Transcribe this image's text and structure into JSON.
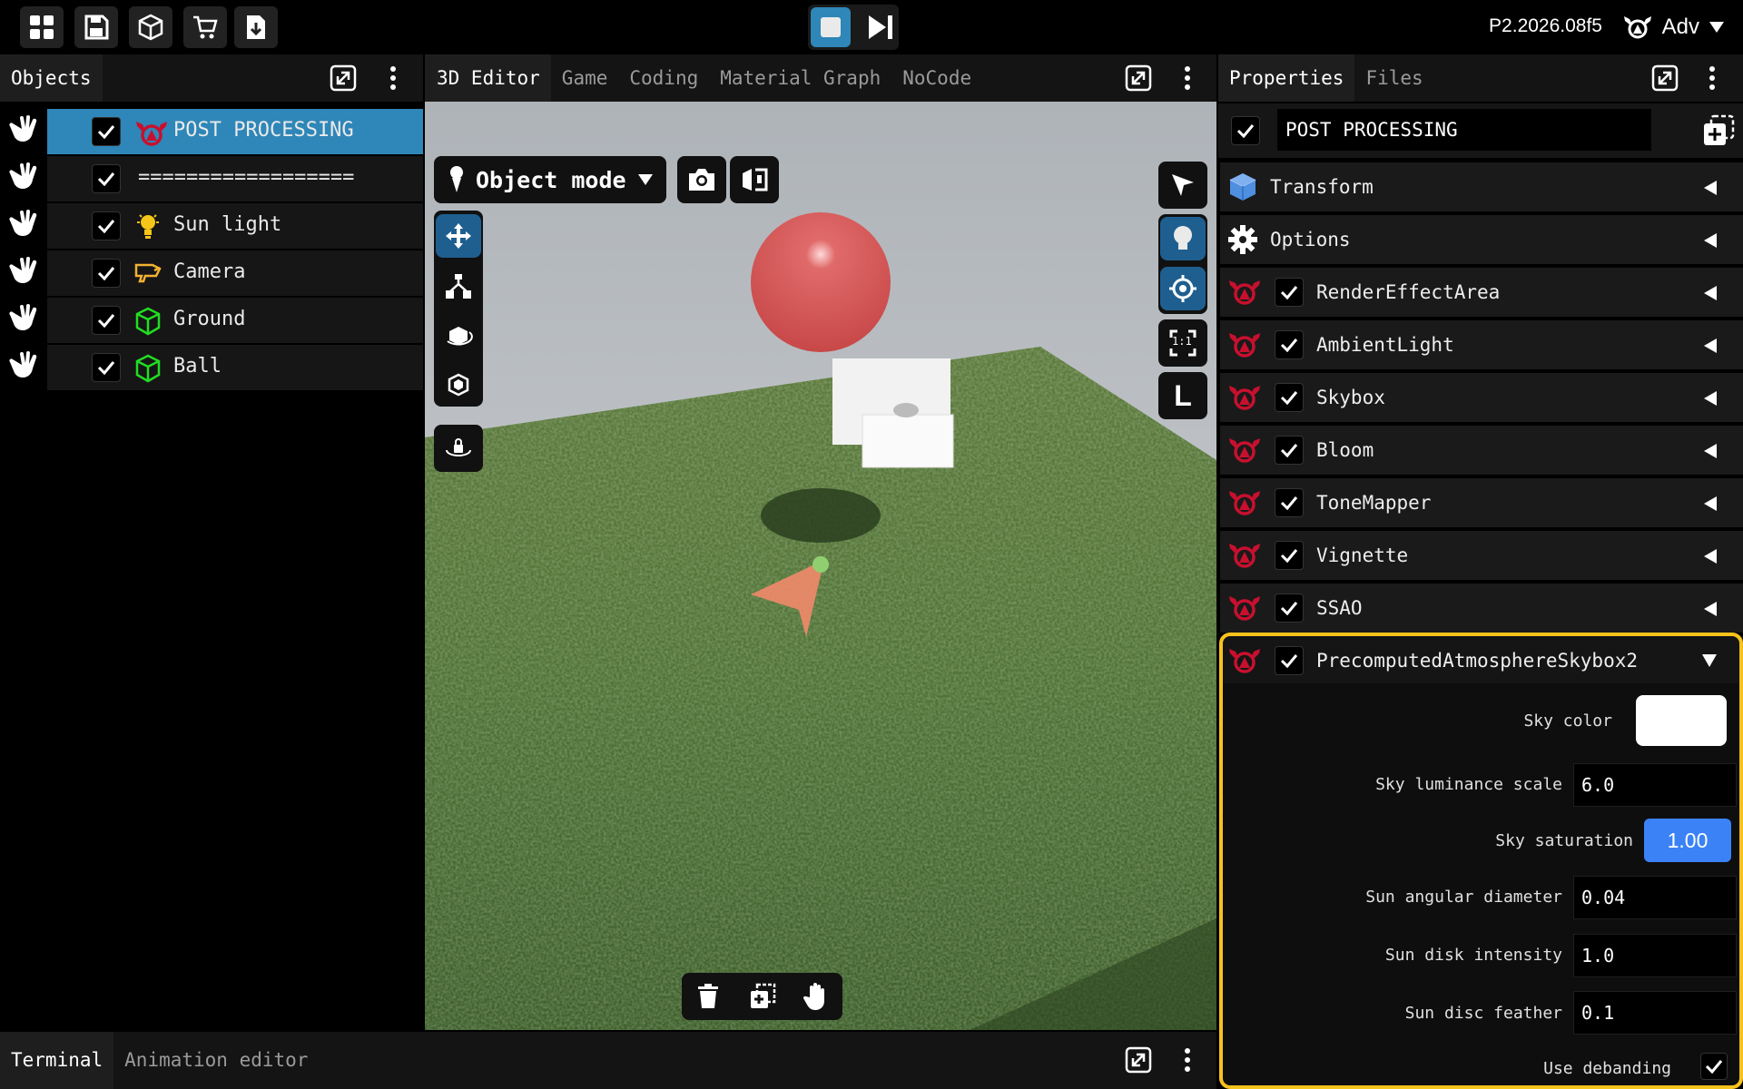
{
  "app": {
    "version": "P2.2026.08f5",
    "mode_label": "Adv"
  },
  "toolbar": {
    "icons": [
      "grid-icon",
      "save-icon",
      "cube-icon",
      "cart-icon",
      "download-icon"
    ],
    "play_controls": [
      "stop-icon",
      "step-forward-icon"
    ]
  },
  "objects_panel": {
    "tab": "Objects",
    "items": [
      {
        "label": "POST PROCESSING",
        "icon": "post-processing-icon",
        "selected": true,
        "checked": true
      },
      {
        "label": "==================",
        "icon": "",
        "selected": false,
        "checked": true
      },
      {
        "label": "Sun light",
        "icon": "lightbulb-icon",
        "selected": false,
        "checked": true
      },
      {
        "label": "Camera",
        "icon": "camera-icon",
        "selected": false,
        "checked": true
      },
      {
        "label": "Ground",
        "icon": "mesh-icon",
        "selected": false,
        "checked": true
      },
      {
        "label": "Ball",
        "icon": "mesh-icon",
        "selected": false,
        "checked": true
      }
    ]
  },
  "editor": {
    "tabs": [
      "3D Editor",
      "Game",
      "Coding",
      "Material Graph",
      "NoCode"
    ],
    "active_tab": "3D Editor",
    "mode_select": "Object mode",
    "right_tools": {
      "scale_label": "1:1",
      "local_label": "L"
    }
  },
  "properties": {
    "tabs": [
      "Properties",
      "Files"
    ],
    "active_tab": "Properties",
    "object_name": "POST PROCESSING",
    "sections": [
      {
        "label": "Transform",
        "icon": "cube-icon",
        "has_checkbox": false
      },
      {
        "label": "Options",
        "icon": "gear-icon",
        "has_checkbox": false
      },
      {
        "label": "RenderEffectArea",
        "icon": "post-processing-icon",
        "has_checkbox": true
      },
      {
        "label": "AmbientLight",
        "icon": "post-processing-icon",
        "has_checkbox": true
      },
      {
        "label": "Skybox",
        "icon": "post-processing-icon",
        "has_checkbox": true
      },
      {
        "label": "Bloom",
        "icon": "post-processing-icon",
        "has_checkbox": true
      },
      {
        "label": "ToneMapper",
        "icon": "post-processing-icon",
        "has_checkbox": true
      },
      {
        "label": "Vignette",
        "icon": "post-processing-icon",
        "has_checkbox": true
      },
      {
        "label": "SSAO",
        "icon": "post-processing-icon",
        "has_checkbox": true
      }
    ],
    "expanded": {
      "label": "PrecomputedAtmosphereSkybox2",
      "fields": {
        "sky_color": {
          "label": "Sky color",
          "value": "#ffffff"
        },
        "sky_luminance_scale": {
          "label": "Sky luminance scale",
          "value": "6.0"
        },
        "sky_saturation": {
          "label": "Sky saturation",
          "value": "1.00"
        },
        "sun_angular_diameter": {
          "label": "Sun angular diameter",
          "value": "0.04"
        },
        "sun_disk_intensity": {
          "label": "Sun disk intensity",
          "value": "1.0"
        },
        "sun_disc_feather": {
          "label": "Sun disc feather",
          "value": "0.1"
        },
        "use_debanding": {
          "label": "Use debanding",
          "checked": true
        }
      }
    }
  },
  "bottom_panel": {
    "tabs": [
      "Terminal",
      "Animation editor"
    ],
    "active_tab": "Terminal"
  },
  "colors": {
    "accent_blue": "#2f86b8",
    "highlight": "#f6c21c",
    "slider": "#3b82f6",
    "brand_red": "#c8102e",
    "mesh_green": "#22dd22"
  }
}
